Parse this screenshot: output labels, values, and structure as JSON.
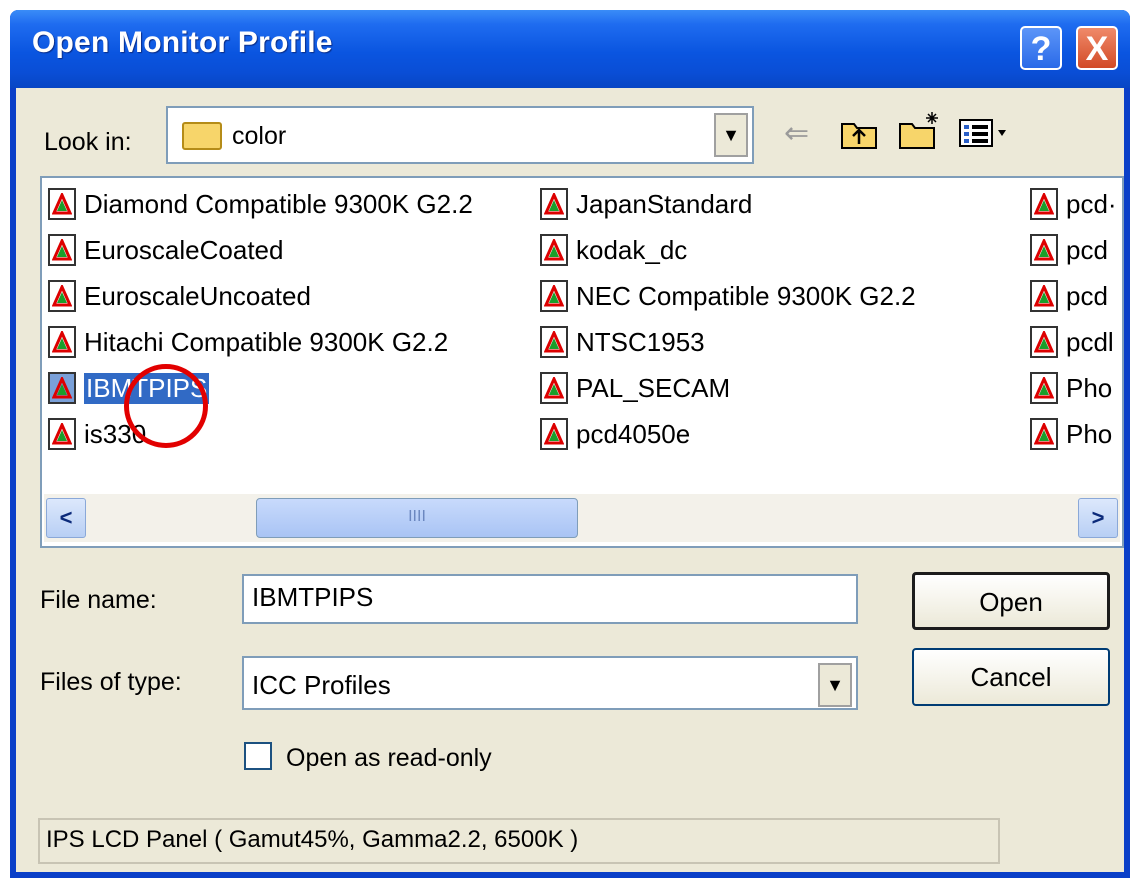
{
  "window": {
    "title": "Open Monitor Profile",
    "help_glyph": "?",
    "close_glyph": "X"
  },
  "lookin": {
    "label": "Look in:",
    "value": "color",
    "icon": "folder-icon"
  },
  "toolbar": {
    "back_glyph": "⇐",
    "up_icon": "folder-up-icon",
    "new_folder_icon": "new-folder-icon",
    "views_icon": "views-menu-icon"
  },
  "files": [
    {
      "name": "Diamond Compatible 9300K G2.2"
    },
    {
      "name": "EuroscaleCoated"
    },
    {
      "name": "EuroscaleUncoated"
    },
    {
      "name": "Hitachi Compatible 9300K G2.2"
    },
    {
      "name": "IBMTPIPS",
      "selected": true
    },
    {
      "name": "is330"
    },
    {
      "name": "JapanStandard"
    },
    {
      "name": "kodak_dc"
    },
    {
      "name": "NEC Compatible 9300K G2.2"
    },
    {
      "name": "NTSC1953"
    },
    {
      "name": "PAL_SECAM"
    },
    {
      "name": "pcd4050e"
    },
    {
      "name": "pcd·"
    },
    {
      "name": "pcd"
    },
    {
      "name": "pcd"
    },
    {
      "name": "pcdl"
    },
    {
      "name": "Pho"
    },
    {
      "name": "Pho"
    }
  ],
  "scrollbar": {
    "left_glyph": "<",
    "right_glyph": ">",
    "grip": "IIII"
  },
  "form": {
    "file_name_label": "File name:",
    "file_name_value": "IBMTPIPS",
    "file_type_label": "Files of type:",
    "file_type_value": "ICC Profiles",
    "readonly_label": "Open as read-only",
    "readonly_checked": false
  },
  "buttons": {
    "open": "Open",
    "cancel": "Cancel"
  },
  "status": "IPS LCD Panel ( Gamut45%, Gamma2.2, 6500K )",
  "colors": {
    "titlebar": "#0a55e0",
    "selection": "#316ac5",
    "annotation": "#e20000"
  }
}
